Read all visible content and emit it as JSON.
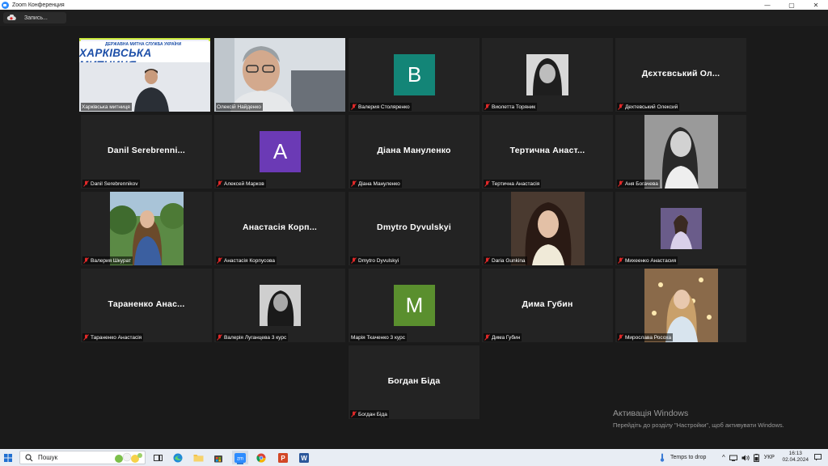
{
  "window": {
    "title": "Zoom Конференция",
    "controls": [
      "—",
      "▢",
      "✕"
    ]
  },
  "recording": {
    "label": "Запись..."
  },
  "participants": [
    {
      "name": "Харківська митниця",
      "type": "video",
      "active": true,
      "banner_small": "ДЕРЖАВНА МИТНА СЛУЖБА УКРАЇНИ",
      "banner_big": "ХАРКІВСЬКА МИТНИЦЯ"
    },
    {
      "name": "Олексій Найденко",
      "type": "video"
    },
    {
      "name": "Валерия Столяренко",
      "type": "avatar",
      "initial": "B",
      "color": "#138577"
    },
    {
      "name": "Виолетта Торяник",
      "type": "photo"
    },
    {
      "name": "Дехтевський Олексий",
      "type": "name",
      "display": "Дєхтєвський Ол..."
    },
    {
      "name": "Danil Serebrennikov",
      "type": "name",
      "display": "Danil Serebrenni..."
    },
    {
      "name": "Алексей Марков",
      "type": "avatar",
      "initial": "A",
      "color": "#6b3ab5"
    },
    {
      "name": "Діана Мануленко",
      "type": "name",
      "display": "Діана Мануленко"
    },
    {
      "name": "Тертична Анастасія",
      "type": "name",
      "display": "Тертична Анаст..."
    },
    {
      "name": "Аня Богачева",
      "type": "photo"
    },
    {
      "name": "Валерия Шкурат",
      "type": "photo"
    },
    {
      "name": "Анастасія Корпусова",
      "type": "name",
      "display": "Анастасія Корп..."
    },
    {
      "name": "Dmytro Dyvulskyi",
      "type": "name",
      "display": "Dmytro Dyvulskyi"
    },
    {
      "name": "Daria Gunkina",
      "type": "photo"
    },
    {
      "name": "Михеенко Анастасия",
      "type": "photo"
    },
    {
      "name": "Тараненко Анастасія",
      "type": "name",
      "display": "Тараненко Анас..."
    },
    {
      "name": "Валерія Луганцева 3 курс",
      "type": "photo"
    },
    {
      "name": "Марія Ткаченко 3 курс",
      "type": "avatar",
      "initial": "M",
      "color": "#5a8f2e"
    },
    {
      "name": "Дима Губин",
      "type": "name",
      "display": "Дима Губин"
    },
    {
      "name": "Мирослава Росоха",
      "type": "photo"
    },
    {
      "name": "Богдан Біда",
      "type": "name",
      "display": "Богдан Біда"
    }
  ],
  "watermark": {
    "line1": "Активація Windows",
    "line2": "Перейдіть до розділу \"Настройки\", щоб активувати Windows."
  },
  "taskbar": {
    "search_label": "Пошук",
    "tray_weather": "Temps to drop",
    "language": "УКР",
    "time": "16:13",
    "date": "02.04.2024",
    "apps": [
      "task-view-icon",
      "edge-icon",
      "file-explorer-icon",
      "store-icon",
      "zoom-icon",
      "chrome-icon",
      "powerpoint-icon",
      "word-icon"
    ]
  },
  "colors": {
    "active_speaker": "#c8e63c",
    "tile_bg": "#232323",
    "gallery_bg": "#1a1a1a",
    "mute_red": "#e02828"
  }
}
